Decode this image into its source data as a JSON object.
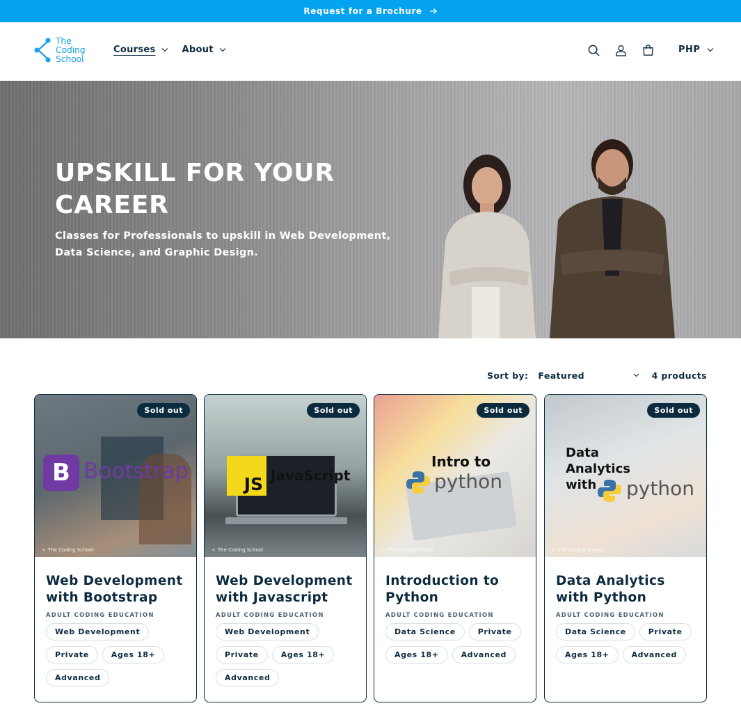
{
  "announcement": {
    "text": "Request for a Brochure"
  },
  "brand": {
    "line1": "The",
    "line2": "Coding",
    "line3": "School"
  },
  "nav": [
    {
      "label": "Courses"
    },
    {
      "label": "About"
    }
  ],
  "header_icons": [
    "search-icon",
    "account-icon",
    "cart-icon"
  ],
  "currency": "PHP",
  "hero": {
    "title": "UPSKILL FOR YOUR CAREER",
    "subtitle": "Classes for Professionals to upskill in Web Development, Data Science, and Graphic Design."
  },
  "sort": {
    "label": "Sort by:",
    "value": "Featured",
    "count": "4 products"
  },
  "products": [
    {
      "title": "Web Development with Bootstrap",
      "vendor": "ADULT CODING EDUCATION",
      "badge": "Sold out",
      "image_text": "Bootstrap",
      "watermark": "The Coding School",
      "tags": [
        "Web Development",
        "Private",
        "Ages 18+",
        "Advanced"
      ]
    },
    {
      "title": "Web Development with Javascript",
      "vendor": "ADULT CODING EDUCATION",
      "badge": "Sold out",
      "image_text": "JavaScript",
      "image_mark": "JS",
      "watermark": "The Coding School",
      "tags": [
        "Web Development",
        "Private",
        "Ages 18+",
        "Advanced"
      ]
    },
    {
      "title": "Introduction to Python",
      "vendor": "ADULT CODING EDUCATION",
      "badge": "Sold out",
      "image_text_top": "Intro to",
      "image_text": "python",
      "watermark": "The Coding School",
      "tags": [
        "Data Science",
        "Private",
        "Ages 18+",
        "Advanced"
      ]
    },
    {
      "title": "Data Analytics with Python",
      "vendor": "ADULT CODING EDUCATION",
      "badge": "Sold out",
      "image_text_top": "Data Analytics with",
      "image_text": "python",
      "watermark": "The Coding School",
      "tags": [
        "Data Science",
        "Private",
        "Ages 18+",
        "Advanced"
      ]
    }
  ],
  "colors": {
    "announce": "#03a3f0",
    "navy": "#0c2b3f",
    "brand": "#1aa3e8"
  }
}
